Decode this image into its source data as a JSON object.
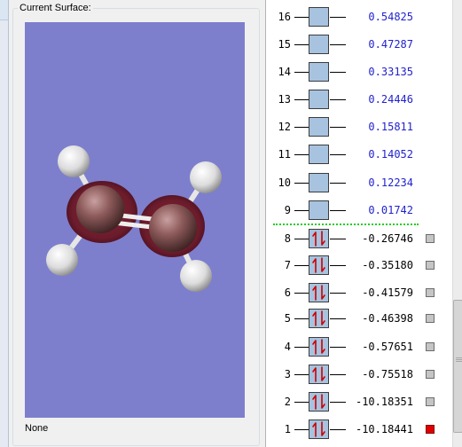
{
  "surface_panel": {
    "label": "Current Surface:",
    "selected_surface": "None",
    "viewer_background": "#7d7fcd"
  },
  "orbitals": [
    {
      "number": "16",
      "energy": "0.54825",
      "occupied": false
    },
    {
      "number": "15",
      "energy": "0.47287",
      "occupied": false
    },
    {
      "number": "14",
      "energy": "0.33135",
      "occupied": false
    },
    {
      "number": "13",
      "energy": "0.24446",
      "occupied": false
    },
    {
      "number": "12",
      "energy": "0.15811",
      "occupied": false
    },
    {
      "number": "11",
      "energy": "0.14052",
      "occupied": false
    },
    {
      "number": "10",
      "energy": "0.12234",
      "occupied": false
    },
    {
      "number": "9",
      "energy": "0.01742",
      "occupied": false
    },
    {
      "number": "8",
      "energy": "-0.26746",
      "occupied": true,
      "selected": false
    },
    {
      "number": "7",
      "energy": "-0.35180",
      "occupied": true,
      "selected": false
    },
    {
      "number": "6",
      "energy": "-0.41579",
      "occupied": true,
      "selected": false
    },
    {
      "number": "5",
      "energy": "-0.46398",
      "occupied": true,
      "selected": false
    },
    {
      "number": "4",
      "energy": "-0.57651",
      "occupied": true,
      "selected": false
    },
    {
      "number": "3",
      "energy": "-0.75518",
      "occupied": true,
      "selected": false
    },
    {
      "number": "2",
      "energy": "-10.18351",
      "occupied": true,
      "selected": false
    },
    {
      "number": "1",
      "energy": "-10.18441",
      "occupied": true,
      "selected": true
    }
  ],
  "colors": {
    "virtual_energy": "#2222cc",
    "occupied_energy": "#000000",
    "selected_marker": "#dd0000",
    "homo_lumo_separator": "#22cc22"
  }
}
